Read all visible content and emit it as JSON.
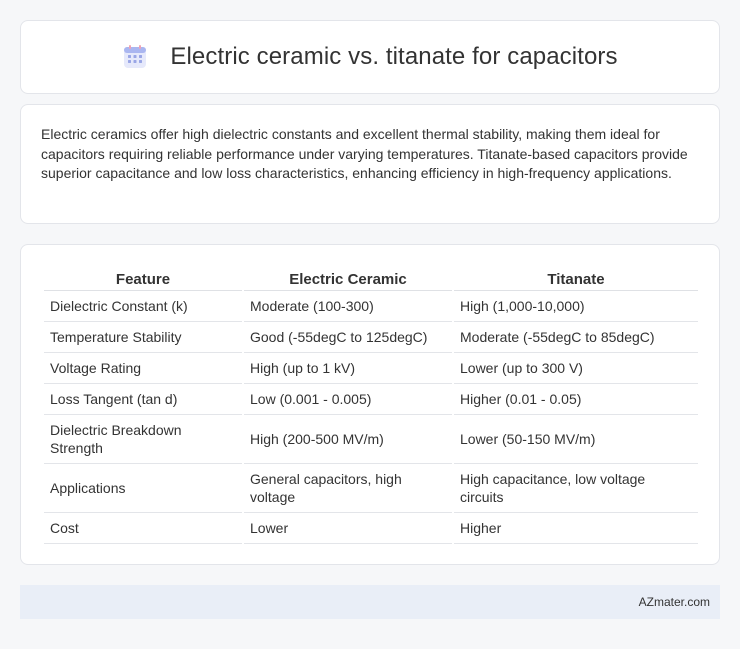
{
  "header": {
    "title": "Electric ceramic vs. titanate for capacitors",
    "icon": "calendar-grid-icon",
    "icon_color": "#7f8fd9"
  },
  "intro": {
    "text": "Electric ceramics offer high dielectric constants and excellent thermal stability, making them ideal for capacitors requiring reliable performance under varying temperatures. Titanate-based capacitors provide superior capacitance and low loss characteristics, enhancing efficiency in high-frequency applications."
  },
  "table": {
    "headers": [
      "Feature",
      "Electric Ceramic",
      "Titanate"
    ],
    "rows": [
      [
        "Dielectric Constant (k)",
        "Moderate (100-300)",
        "High (1,000-10,000)"
      ],
      [
        "Temperature Stability",
        "Good (-55degC to 125degC)",
        "Moderate (-55degC to 85degC)"
      ],
      [
        "Voltage Rating",
        "High (up to 1 kV)",
        "Lower (up to 300 V)"
      ],
      [
        "Loss Tangent (tan d)",
        "Low (0.001 - 0.005)",
        "Higher (0.01 - 0.05)"
      ],
      [
        "Dielectric Breakdown Strength",
        "High (200-500 MV/m)",
        "Lower (50-150 MV/m)"
      ],
      [
        "Applications",
        "General capacitors, high voltage",
        "High capacitance, low voltage circuits"
      ],
      [
        "Cost",
        "Lower",
        "Higher"
      ]
    ]
  },
  "footer": {
    "site": "AZmater.com"
  }
}
